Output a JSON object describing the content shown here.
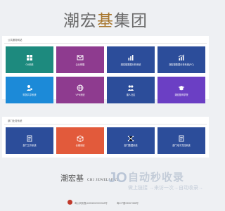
{
  "header": {
    "logo_text_a": "潮宏",
    "logo_text_accent": "基",
    "logo_text_b": "集团"
  },
  "section1": {
    "title": "公共服务网站",
    "tiles": [
      {
        "label": "OA系统",
        "color": "#1d8a7e",
        "icon": "grid-icon"
      },
      {
        "label": "企业邮箱",
        "color": "#8e3b8f",
        "icon": "mail-icon"
      },
      {
        "label": "潮宏基数据分析系统",
        "color": "#2c4d9a",
        "icon": "chart-icon"
      },
      {
        "label": "潮宏基数据分析系统(PC)",
        "color": "#2c4d9a",
        "icon": "chart-up-icon"
      },
      {
        "label": "财务共享系统",
        "color": "#1c8ad8",
        "icon": "user-money-icon"
      },
      {
        "label": "VPN系统",
        "color": "#8e3b8f",
        "icon": "globe-icon"
      },
      {
        "label": "潮人社区",
        "color": "#2c4d9a",
        "icon": "people-icon"
      },
      {
        "label": "潮宏基商学院",
        "color": "#6b3fc4",
        "icon": "graduation-icon"
      }
    ]
  },
  "section2": {
    "title": "部门业务系统",
    "tiles": [
      {
        "label": "部门工作系统",
        "color": "#2c4d9a",
        "icon": "document-icon"
      },
      {
        "label": "仓储系统",
        "color": "#e25a3b",
        "icon": "box-icon"
      },
      {
        "label": "部门数据系统",
        "color": "#2c4d9a",
        "icon": "network-icon"
      },
      {
        "label": "部门电子文档系统",
        "color": "#2c4d9a",
        "icon": "document-icon"
      }
    ]
  },
  "footer": {
    "logo_cn": "潮宏基",
    "logo_en": "CHJ JEWELLERY",
    "left_text": "粤公网安备44051502000318号",
    "right_text": "粤ICP备05067386号"
  },
  "watermark": {
    "logo": "JO",
    "name": "自动秒收录",
    "sub": "做上链接 →来访一次→自动收录→"
  },
  "colors": {
    "background": "#eef0f3",
    "panel": "#ffffff"
  }
}
